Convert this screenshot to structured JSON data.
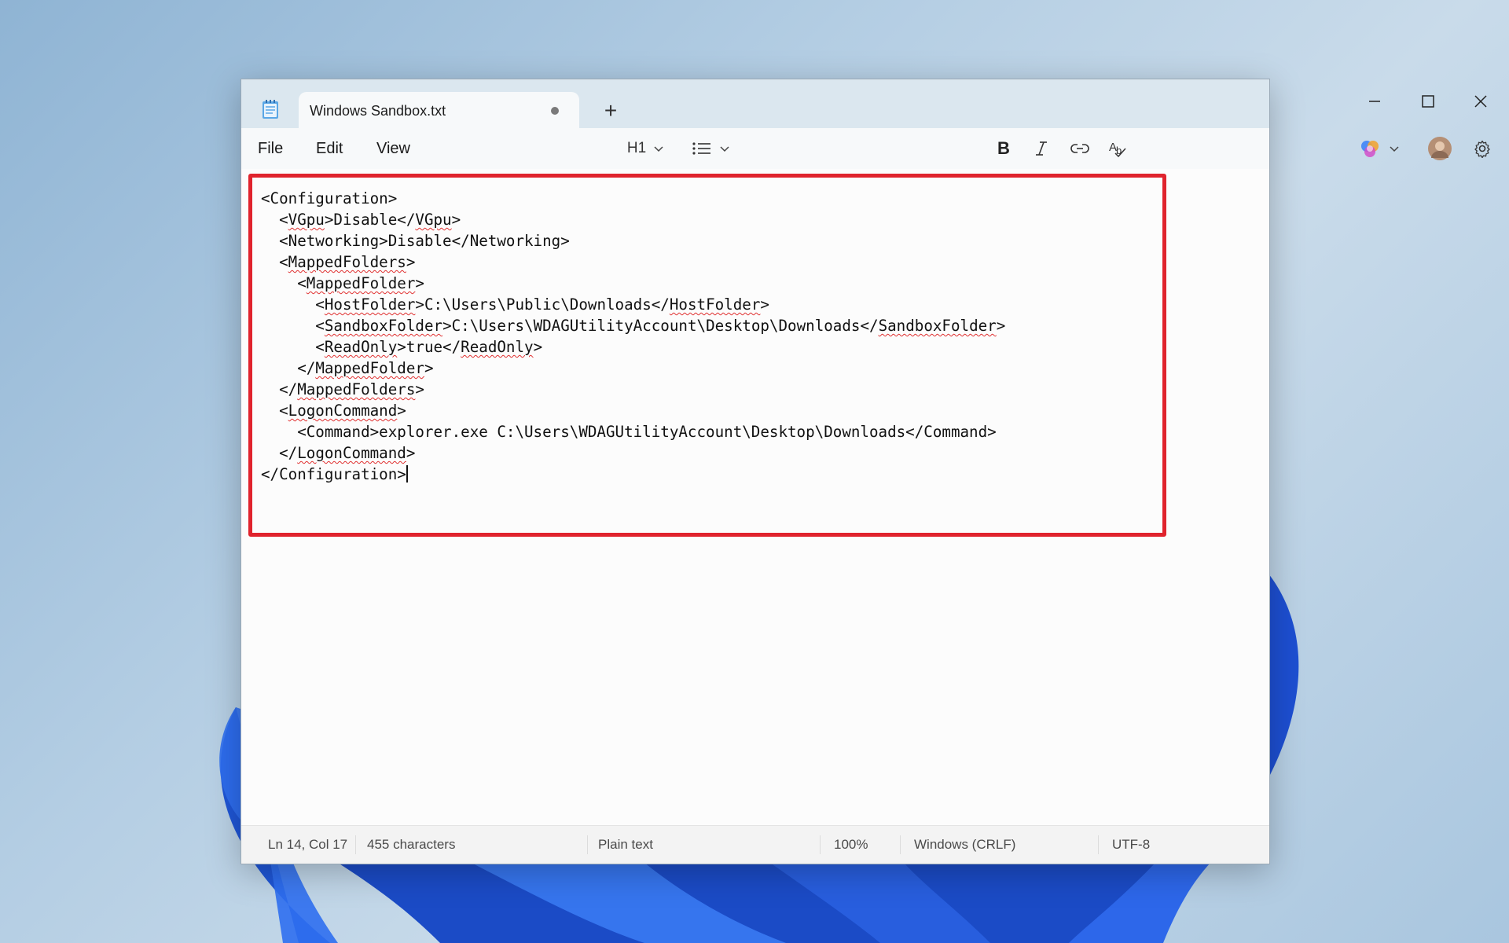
{
  "app": {
    "tab_title": "Windows Sandbox.txt",
    "icon": "notepad-icon"
  },
  "window_controls": [
    "minimize-icon",
    "maximize-icon",
    "close-icon"
  ],
  "menu": {
    "file": "File",
    "edit": "Edit",
    "view": "View"
  },
  "toolbar": {
    "heading": "H1",
    "list_icon": "bulleted-list-icon",
    "bold_icon": "bold-icon",
    "italic_icon": "italic-icon",
    "link_icon": "link-icon",
    "clear_format_icon": "clear-formatting-icon",
    "copilot_icon": "copilot-icon",
    "settings_icon": "gear-icon"
  },
  "editor": {
    "highlight_color": "#e0232d",
    "lines": [
      "<Configuration>",
      "  <VGpu>Disable</VGpu>",
      "  <Networking>Disable</Networking>",
      "  <MappedFolders>",
      "    <MappedFolder>",
      "      <HostFolder>C:\\Users\\Public\\Downloads</HostFolder>",
      "      <SandboxFolder>C:\\Users\\WDAGUtilityAccount\\Desktop\\Downloads</SandboxFolder>",
      "      <ReadOnly>true</ReadOnly>",
      "    </MappedFolder>",
      "  </MappedFolders>",
      "  <LogonCommand>",
      "    <Command>explorer.exe C:\\Users\\WDAGUtilityAccount\\Desktop\\Downloads</Command>",
      "  </LogonCommand>",
      "</Configuration>"
    ]
  },
  "status": {
    "position": "Ln 14, Col 17",
    "characters": "455 characters",
    "format": "Plain text",
    "zoom": "100%",
    "line_ending": "Windows (CRLF)",
    "encoding": "UTF-8"
  }
}
